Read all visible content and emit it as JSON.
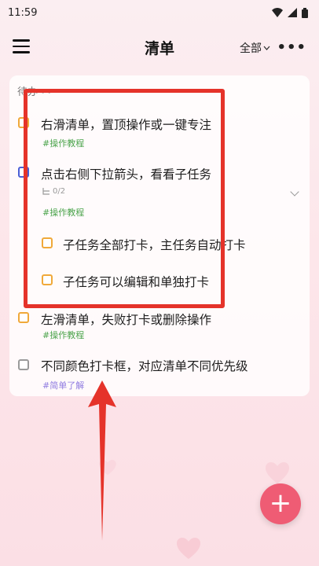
{
  "status": {
    "time": "11:59"
  },
  "header": {
    "title": "清单",
    "filter_label": "全部",
    "more": "•••"
  },
  "section": {
    "label": "待办"
  },
  "tasks": [
    {
      "text": "右滑清单，置顶操作或一键专注",
      "tag": "#操作教程"
    },
    {
      "text": "点击右侧下拉箭头，看看子任务",
      "subcount": "0/2",
      "tag": "#操作教程"
    },
    {
      "text": "子任务全部打卡，主任务自动打卡"
    },
    {
      "text": "子任务可以编辑和单独打卡"
    },
    {
      "text": "左滑清单，失败打卡或删除操作",
      "tag": "#操作教程"
    },
    {
      "text": "不同颜色打卡框，对应清单不同优先级",
      "tag": "#简单了解"
    }
  ],
  "fab": {
    "label": "+"
  },
  "colors": {
    "accent": "#ef5c74",
    "highlight": "#e5332a",
    "priority_orange": "#f0a93a",
    "priority_blue": "#4a5fd6",
    "priority_gray": "#9a9a9a",
    "tag_green": "#4aa34a",
    "tag_purple": "#8f7be0"
  },
  "icons": [
    "menu-icon",
    "wifi-icon",
    "signal-icon",
    "battery-icon",
    "chevron-down-icon",
    "subtask-icon",
    "plus-icon",
    "arrow-up-icon",
    "heart-icon"
  ]
}
